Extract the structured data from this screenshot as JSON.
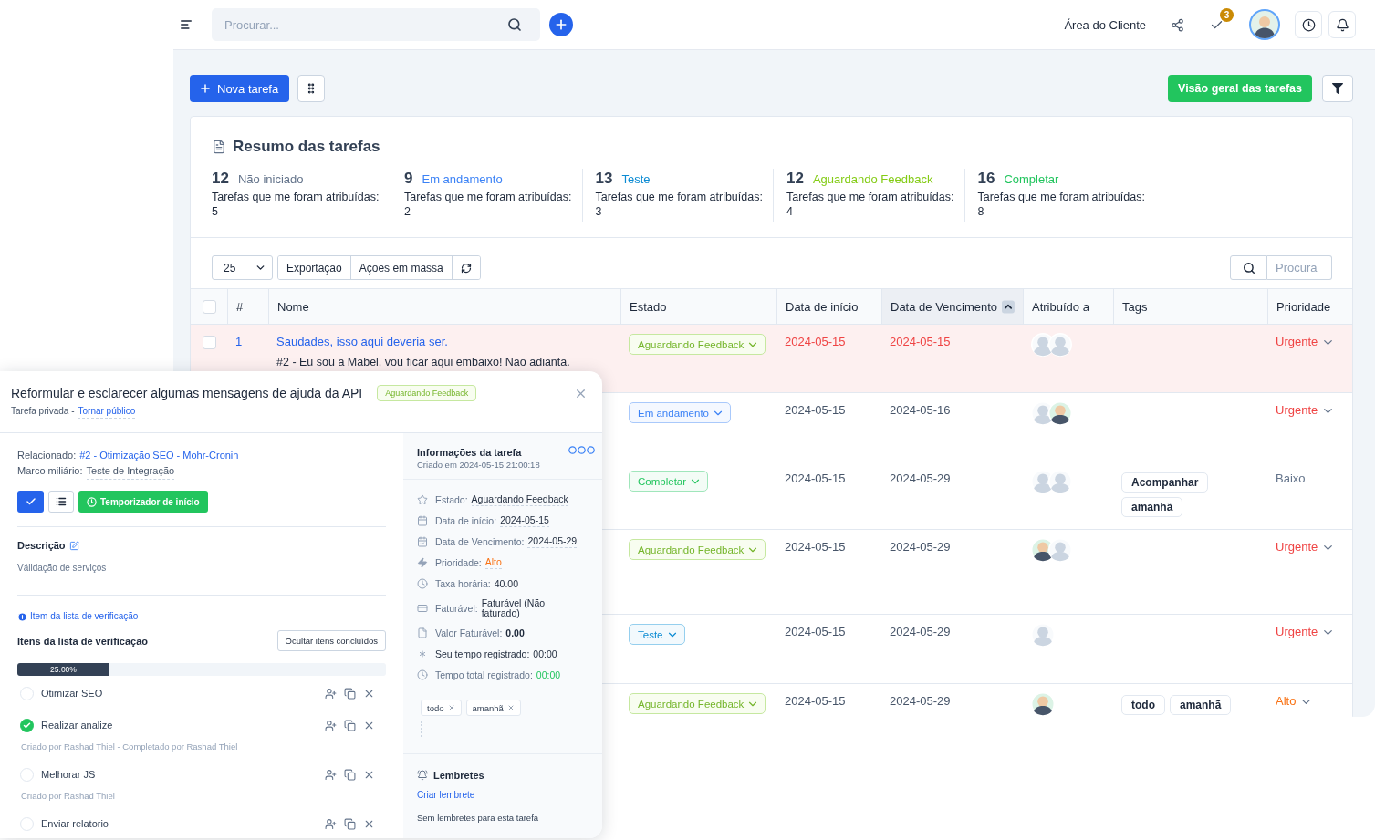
{
  "topbar": {
    "search": {
      "placeholder": "Procurar..."
    },
    "client_area": "Área do Cliente",
    "badge": "3"
  },
  "toolbar": {
    "new_task": "Nova tarefa",
    "overview": "Visão geral das tarefas"
  },
  "summary": {
    "title": "Resumo das tarefas",
    "stats": [
      {
        "count": "12",
        "label": "Não iniciado",
        "color": "#64748b",
        "caption": "Tarefas que me foram atribuídas:",
        "assigned": "5"
      },
      {
        "count": "9",
        "label": "Em andamento",
        "color": "#3b82f6",
        "caption": "Tarefas que me foram atribuídas:",
        "assigned": "2"
      },
      {
        "count": "13",
        "label": "Teste",
        "color": "#0b8bd3",
        "caption": "Tarefas que me foram atribuídas:",
        "assigned": "3"
      },
      {
        "count": "12",
        "label": "Aguardando Feedback",
        "color": "#84cc16",
        "caption": "Tarefas que me foram atribuídas:",
        "assigned": "4"
      },
      {
        "count": "16",
        "label": "Completar",
        "color": "#22c55e",
        "caption": "Tarefas que me foram atribuídas:",
        "assigned": "8"
      }
    ]
  },
  "table_controls": {
    "page_size": "25",
    "actions": [
      "Exportação",
      "Ações em massa"
    ],
    "search": {
      "placeholder": "Procura"
    }
  },
  "table": {
    "select_all": {
      "checked": false
    },
    "columns": [
      {
        "label": "#",
        "sorted": false
      },
      {
        "label": "Nome",
        "sorted": false
      },
      {
        "label": "Estado",
        "sorted": false
      },
      {
        "label": "Data de início",
        "sorted": false
      },
      {
        "label": "Data de Vencimento",
        "sorted": true
      },
      {
        "label": "Atribuído a",
        "sorted": false
      },
      {
        "label": "Tags",
        "sorted": false
      },
      {
        "label": "Prioridade",
        "sorted": false
      }
    ],
    "rows": [
      {
        "checked": false,
        "number": "1",
        "name": "Saudades, isso aqui deveria ser.",
        "subtitle": "#2 - Eu sou a Mabel, vou ficar aqui embaixo! Não adianta.",
        "status": {
          "label": "Aguardando Feedback",
          "kind": "feedback"
        },
        "start": "2024-05-15",
        "due": "2024-05-15",
        "overdue": true,
        "assignees": [
          {
            "kind": "placeholder"
          },
          {
            "kind": "placeholder"
          }
        ],
        "priority": {
          "label": "Urgente",
          "kind": "urgent"
        }
      },
      {
        "status": {
          "label": "Em andamento",
          "kind": "in_progress"
        },
        "start": "2024-05-15",
        "due": "2024-05-16",
        "overdue": false,
        "assignees": [
          {
            "kind": "placeholder"
          },
          {
            "kind": "photo"
          }
        ],
        "priority": {
          "label": "Urgente",
          "kind": "urgent"
        }
      },
      {
        "status": {
          "label": "Completar",
          "kind": "complete"
        },
        "start": "2024-05-15",
        "due": "2024-05-29",
        "overdue": false,
        "assignees": [
          {
            "kind": "placeholder"
          },
          {
            "kind": "placeholder"
          }
        ],
        "tags": [
          "Acompanhar",
          "amanhã"
        ],
        "priority": {
          "label": "Baixo",
          "kind": "low"
        }
      },
      {
        "status": {
          "label": "Aguardando Feedback",
          "kind": "feedback"
        },
        "start": "2024-05-15",
        "due": "2024-05-29",
        "overdue": false,
        "assignees": [
          {
            "kind": "photo"
          },
          {
            "kind": "placeholder"
          }
        ],
        "priority": {
          "label": "Urgente",
          "kind": "urgent"
        }
      },
      {
        "status": {
          "label": "Teste",
          "kind": "testing"
        },
        "start": "2024-05-15",
        "due": "2024-05-29",
        "overdue": false,
        "assignees": [
          {
            "kind": "placeholder"
          }
        ],
        "priority": {
          "label": "Urgente",
          "kind": "urgent"
        }
      },
      {
        "status": {
          "label": "Aguardando Feedback",
          "kind": "feedback"
        },
        "start": "2024-05-15",
        "due": "2024-05-29",
        "overdue": false,
        "assignees": [
          {
            "kind": "photo"
          }
        ],
        "tags": [
          "todo",
          "amanhã"
        ],
        "priority": {
          "label": "Alto",
          "kind": "high"
        }
      }
    ]
  },
  "task_modal": {
    "title": "Reformular e esclarecer algumas mensagens de ajuda da API",
    "status": {
      "label": "Aguardando Feedback",
      "kind": "feedback"
    },
    "privacy": "Tarefa privada -",
    "make_public": "Tornar público",
    "related_label": "Relacionado:",
    "related": "#2 - Otimização SEO - Mohr-Cronin",
    "milestone_label": "Marco miliário:",
    "milestone": "Teste de Integração",
    "timer_button": "Temporizador de início",
    "description_title": "Descrição",
    "description": "Válidação de serviços",
    "add_checklist": "Item da lista de verificação",
    "checklist_title": "Itens da lista de verificação",
    "hide_completed": "Ocultar itens concluídos",
    "progress": {
      "level": 0.25,
      "reading": "25.00%"
    },
    "checklist": [
      {
        "text": "Otimizar SEO",
        "checked": false
      },
      {
        "text": "Realizar analize",
        "checked": true,
        "meta": "Criado por Rashad Thiel - Completado por Rashad Thiel"
      },
      {
        "text": "Melhorar JS",
        "checked": false,
        "meta": "Criado por Rashad Thiel"
      },
      {
        "text": "Enviar relatorio",
        "checked": false
      }
    ],
    "info": {
      "title": "Informações da tarefa",
      "created": "Criado em 2024-05-15 21:00:18",
      "rows": [
        {
          "kind": "status",
          "label": "Estado:",
          "value": "Aguardando Feedback"
        },
        {
          "kind": "start_date",
          "label": "Data de início:",
          "value": "2024-05-15"
        },
        {
          "kind": "due_date",
          "label": "Data de Vencimento:",
          "value": "2024-05-29"
        },
        {
          "kind": "priority",
          "label": "Prioridade:",
          "value": "Alto"
        },
        {
          "kind": "hourly_rate",
          "label": "Taxa horária:",
          "value": "40.00"
        },
        {
          "kind": "billable",
          "label": "Faturável:",
          "value": "Faturável (Não faturado)"
        },
        {
          "kind": "billable_amount",
          "label": "Valor Faturável:",
          "value": "0.00"
        },
        {
          "kind": "my_time",
          "label": "Seu tempo registrado:",
          "value": "00:00"
        },
        {
          "kind": "total_time",
          "label": "Tempo total registrado:",
          "value": "00:00"
        }
      ],
      "tags": [
        "todo",
        "amanhã"
      ]
    },
    "reminders": {
      "title": "Lembretes",
      "create": "Criar lembrete",
      "empty": "Sem lembretes para esta tarefa"
    }
  }
}
